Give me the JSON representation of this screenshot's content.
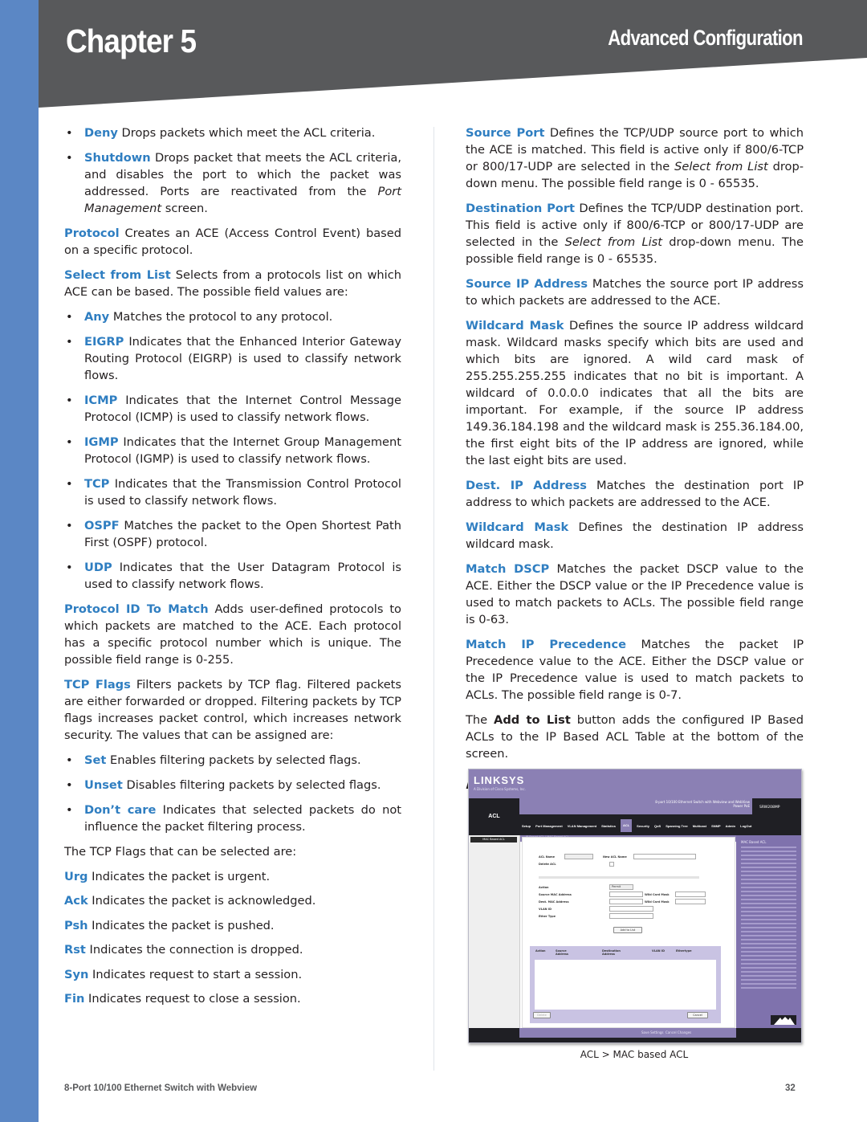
{
  "header": {
    "chapter": "Chapter 5",
    "section": "Advanced Configuration"
  },
  "colors": {
    "left_bar": "#5b87c5",
    "header_bg": "#58595b",
    "term_blue": "#2f7ec1",
    "body_text": "#231f20"
  },
  "left_column": {
    "bullets_action": [
      {
        "term": "Deny",
        "text": " Drops packets which meet the ACL criteria."
      },
      {
        "term": "Shutdown",
        "text_before": " Drops packet that meets the ACL criteria, and disables the port to which the packet was addressed. Ports are reactivated from the ",
        "italic": "Port Management",
        "text_after": " screen."
      }
    ],
    "protocol": {
      "term": "Protocol",
      "text": " Creates an ACE (Access Control Event) based on a specific protocol."
    },
    "select_from_list": {
      "term": "Select from List",
      "text": " Selects from a protocols list on which ACE can be based. The possible field values are:"
    },
    "protocol_values": [
      {
        "term": "Any",
        "text": " Matches the protocol to any protocol."
      },
      {
        "term": "EIGRP",
        "text": " Indicates that the Enhanced Interior Gateway Routing Protocol (EIGRP) is used to classify network flows."
      },
      {
        "term": "ICMP",
        "text": " Indicates that the Internet Control Message Protocol (ICMP) is used to classify network flows."
      },
      {
        "term": "IGMP",
        "text": " Indicates that the Internet Group Management Protocol (IGMP) is used to classify network flows."
      },
      {
        "term": "TCP",
        "text": " Indicates that the Transmission Control Protocol is used to classify network flows."
      },
      {
        "term": "OSPF",
        "text": " Matches the packet to the Open Shortest Path First (OSPF) protocol."
      },
      {
        "term": "UDP",
        "text": " Indicates that the User Datagram Protocol is used to classify network flows."
      }
    ],
    "protocol_id": {
      "term": "Protocol ID To Match",
      "text": " Adds user-defined protocols to which packets are matched to the ACE. Each protocol has a specific protocol number which is unique. The possible field range is 0-255."
    },
    "tcp_flags": {
      "term": "TCP Flags",
      "text": " Filters packets by TCP flag. Filtered packets are either forwarded or dropped. Filtering packets by TCP flags increases packet control, which increases network security. The values that can be assigned are:"
    },
    "tcp_flag_values": [
      {
        "term": "Set",
        "text": " Enables filtering packets by selected flags."
      },
      {
        "term": "Unset",
        "text": " Disables filtering packets by selected flags."
      },
      {
        "term": "Don’t care",
        "text": " Indicates that selected packets do not influence the packet filtering process."
      }
    ],
    "flags_intro": "The TCP Flags that can be selected are:",
    "flags": [
      {
        "term": "Urg",
        "text": " Indicates the packet is urgent."
      },
      {
        "term": "Ack",
        "text": " Indicates the packet is acknowledged."
      },
      {
        "term": "Psh",
        "text": " Indicates the packet is pushed."
      },
      {
        "term": "Rst",
        "text": " Indicates the connection is dropped."
      },
      {
        "term": "Syn",
        "text": " Indicates request to start a session."
      },
      {
        "term": "Fin",
        "text": " Indicates request to close a session."
      }
    ]
  },
  "right_column": {
    "source_port": {
      "term": "Source Port",
      "text_before": " Defines the TCP/UDP source port to which the ACE is matched. This field is active only if 800/6-TCP or 800/17-UDP are selected in the ",
      "italic": "Select from List",
      "text_after": " drop-down menu. The possible field range is 0 - 65535."
    },
    "destination_port": {
      "term": "Destination Port",
      "text_before": " Defines the TCP/UDP destination port. This field is active only if 800/6-TCP or 800/17-UDP are selected in the ",
      "italic": "Select from List",
      "text_after": " drop-down menu. The possible field range is 0 - 65535."
    },
    "source_ip": {
      "term": "Source IP Address",
      "text": " Matches the source port IP address to which packets are addressed to the ACE."
    },
    "wildcard_mask_src": {
      "term": "Wildcard Mask",
      "text": " Defines the source IP address wildcard mask. Wildcard masks specify which bits are used and which bits are ignored. A wild card mask of 255.255.255.255 indicates that no bit is important. A wildcard of 0.0.0.0 indicates that all the bits are important. For example, if the source IP address 149.36.184.198 and the wildcard mask is 255.36.184.00, the first eight bits of the IP address are ignored, while the last eight bits are used."
    },
    "dest_ip": {
      "term": "Dest. IP Address",
      "text": " Matches the destination port IP address to which packets are addressed to the ACE."
    },
    "wildcard_mask_dst": {
      "term": "Wildcard Mask",
      "text": " Defines the destination IP address wildcard mask."
    },
    "match_dscp": {
      "term": "Match DSCP",
      "text": " Matches the packet DSCP value to the ACE. Either the DSCP value or the IP Precedence value is used to match packets to ACLs. The possible field range is 0-63."
    },
    "match_ip_precedence": {
      "term": "Match IP Precedence",
      "text": " Matches the packet IP Precedence value to the ACE. Either the DSCP value or the IP Precedence value is used to match packets to ACLs. The possible field range is 0-7."
    },
    "add_to_list": {
      "before": "The ",
      "bold": "Add to List",
      "after": " button adds the configured IP Based ACLs to the IP Based ACL Table at the bottom of the screen."
    },
    "heading": "ACL > MAC based ACL"
  },
  "screenshot": {
    "logo": "LINKSYS",
    "logo_sub": "A Division of Cisco Systems, Inc.",
    "product_title": "8-port 10/100 Ethernet Switch with Webview and WebView Power PoE",
    "model": "SRW208MP",
    "nav_section": "ACL",
    "tabs": [
      "Setup",
      "Port Management",
      "VLAN Management",
      "Statistics",
      "ACL",
      "Security",
      "QoS",
      "Spanning Tree",
      "Multicast",
      "SNMP",
      "Admin",
      "LogOut"
    ],
    "active_tab": "ACL",
    "breadcrumb": "IP Based ACL  |  MAC Based ACL",
    "side_item": "MAC Based ACL",
    "form": {
      "acl_name_label": "ACL Name",
      "new_acl_name_label": "New ACL Name",
      "delete_acl_label": "Delete ACL",
      "action_label": "Action",
      "action_value": "Permit",
      "source_mac_label": "Source MAC Address",
      "dest_mac_label": "Dest. MAC Address",
      "wildcard_label": "Wild Card Mask",
      "vlan_id_label": "VLAN ID",
      "ether_type_label": "Ether Type",
      "add_to_list_button": "Add to List"
    },
    "table_headers": [
      "Action",
      "Source Address",
      "Destination Address",
      "VLAN ID",
      "Ethertype"
    ],
    "delete_button": "Delete",
    "cancel_button": "Cancel",
    "save_settings": "Save Settings",
    "cancel_changes": "Cancel Changes",
    "help_title": "MAC Based ACL"
  },
  "caption": "ACL > MAC based ACL",
  "footer": {
    "product": "8-Port 10/100 Ethernet Switch with Webview",
    "page_number": "32"
  }
}
